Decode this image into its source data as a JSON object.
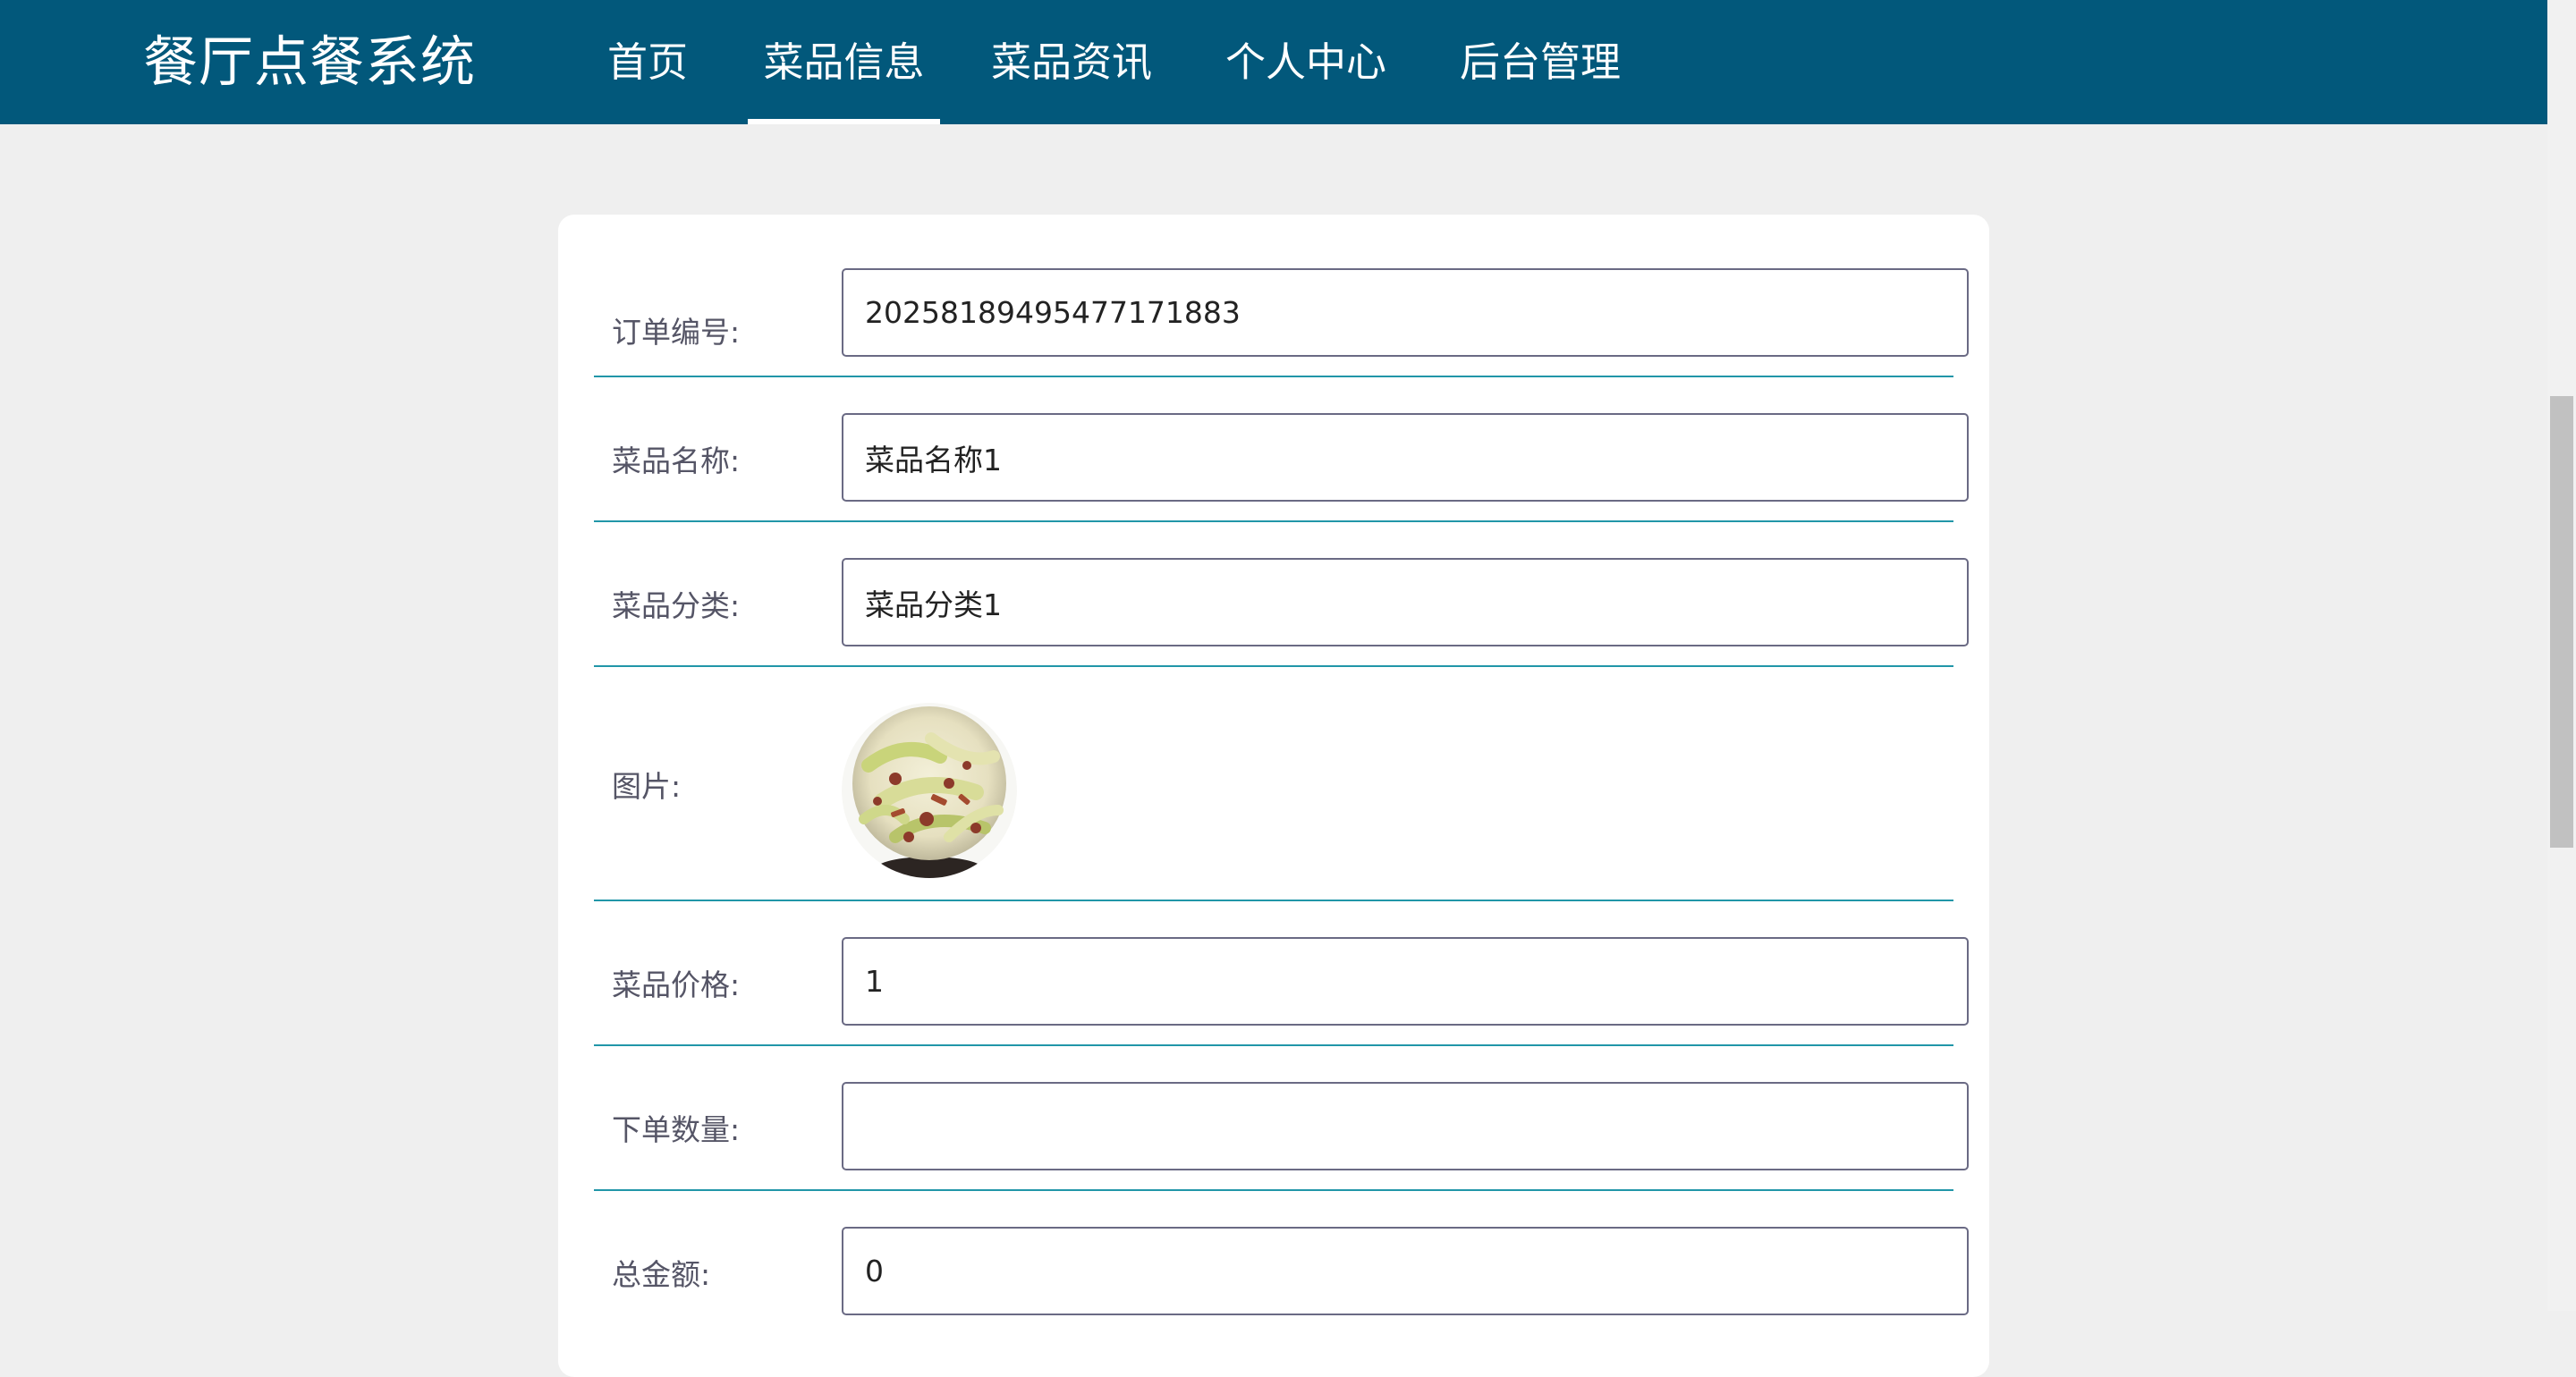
{
  "app": {
    "title": "餐厅点餐系统"
  },
  "nav": {
    "items": [
      {
        "label": "首页",
        "active": false
      },
      {
        "label": "菜品信息",
        "active": true
      },
      {
        "label": "菜品资讯",
        "active": false
      },
      {
        "label": "个人中心",
        "active": false
      },
      {
        "label": "后台管理",
        "active": false
      }
    ]
  },
  "form": {
    "order_no": {
      "label": "订单编号:",
      "value": "20258189495477171883"
    },
    "dish_name": {
      "label": "菜品名称:",
      "value": "菜品名称1"
    },
    "dish_category": {
      "label": "菜品分类:",
      "value": "菜品分类1"
    },
    "image": {
      "label": "图片:",
      "icon": "dish-photo"
    },
    "price": {
      "label": "菜品价格:",
      "value": "1"
    },
    "quantity": {
      "label": "下单数量:",
      "value": ""
    },
    "total": {
      "label": "总金额:",
      "value": "0"
    }
  },
  "colors": {
    "header_bg": "#02587b",
    "divider": "#2196a8",
    "page_bg": "#efefef"
  }
}
